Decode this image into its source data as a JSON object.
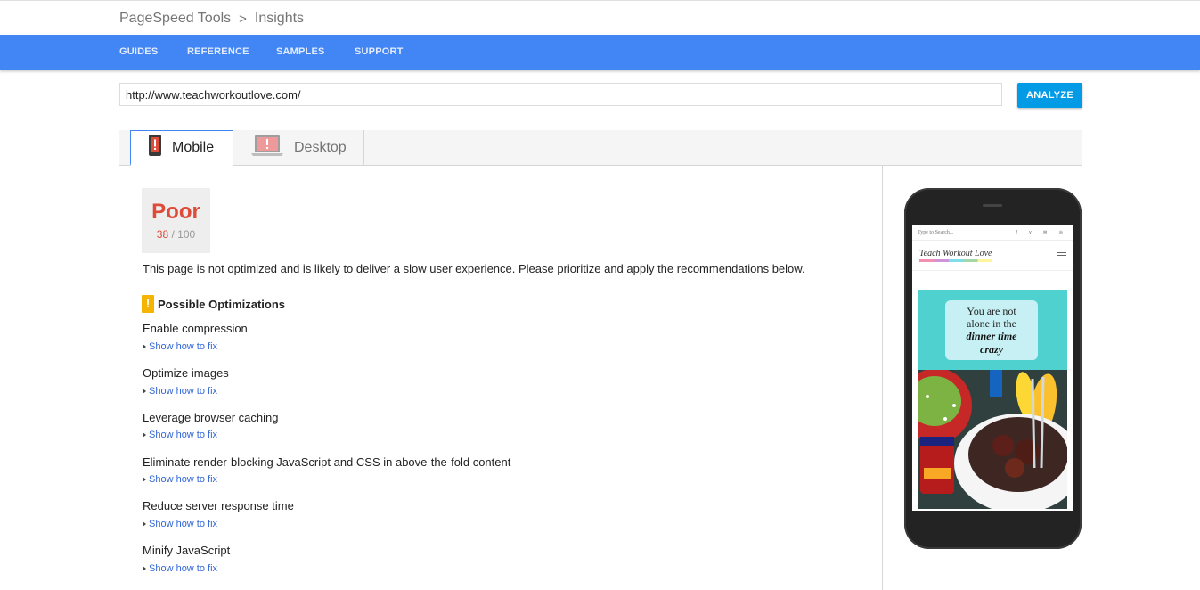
{
  "breadcrumb": {
    "root": "PageSpeed Tools",
    "separator": ">",
    "current": "Insights"
  },
  "nav": {
    "items": [
      "GUIDES",
      "REFERENCE",
      "SAMPLES",
      "SUPPORT"
    ]
  },
  "search": {
    "value": "http://www.teachworkoutlove.com/",
    "button_label": "ANALYZE"
  },
  "tabs": [
    {
      "label": "Mobile",
      "icon": "phone-warning-icon",
      "selected": true
    },
    {
      "label": "Desktop",
      "icon": "laptop-warning-icon",
      "selected": false
    }
  ],
  "score": {
    "label": "Poor",
    "value": "38",
    "sep": "/",
    "max": "100"
  },
  "summary": "This page is not optimized and is likely to deliver a slow user experience. Please prioritize and apply the recommendations below.",
  "optimizations": {
    "heading": "Possible Optimizations",
    "fix_label": "Show how to fix",
    "items": [
      "Enable compression",
      "Optimize images",
      "Leverage browser caching",
      "Eliminate render-blocking JavaScript and CSS in above-the-fold content",
      "Reduce server response time",
      "Minify JavaScript"
    ]
  },
  "preview": {
    "search_text": "Type to Search...",
    "site_logo": "Teach Workout Love",
    "hero_line1": "You are not",
    "hero_line2": "alone in the",
    "hero_line3": "dinner time",
    "hero_line4": "crazy"
  },
  "colors": {
    "nav_blue": "#4285f4",
    "analyze_blue": "#039be5",
    "poor_red": "#dd4b39",
    "warn_amber": "#f4b400",
    "link_blue": "#3367d6"
  }
}
